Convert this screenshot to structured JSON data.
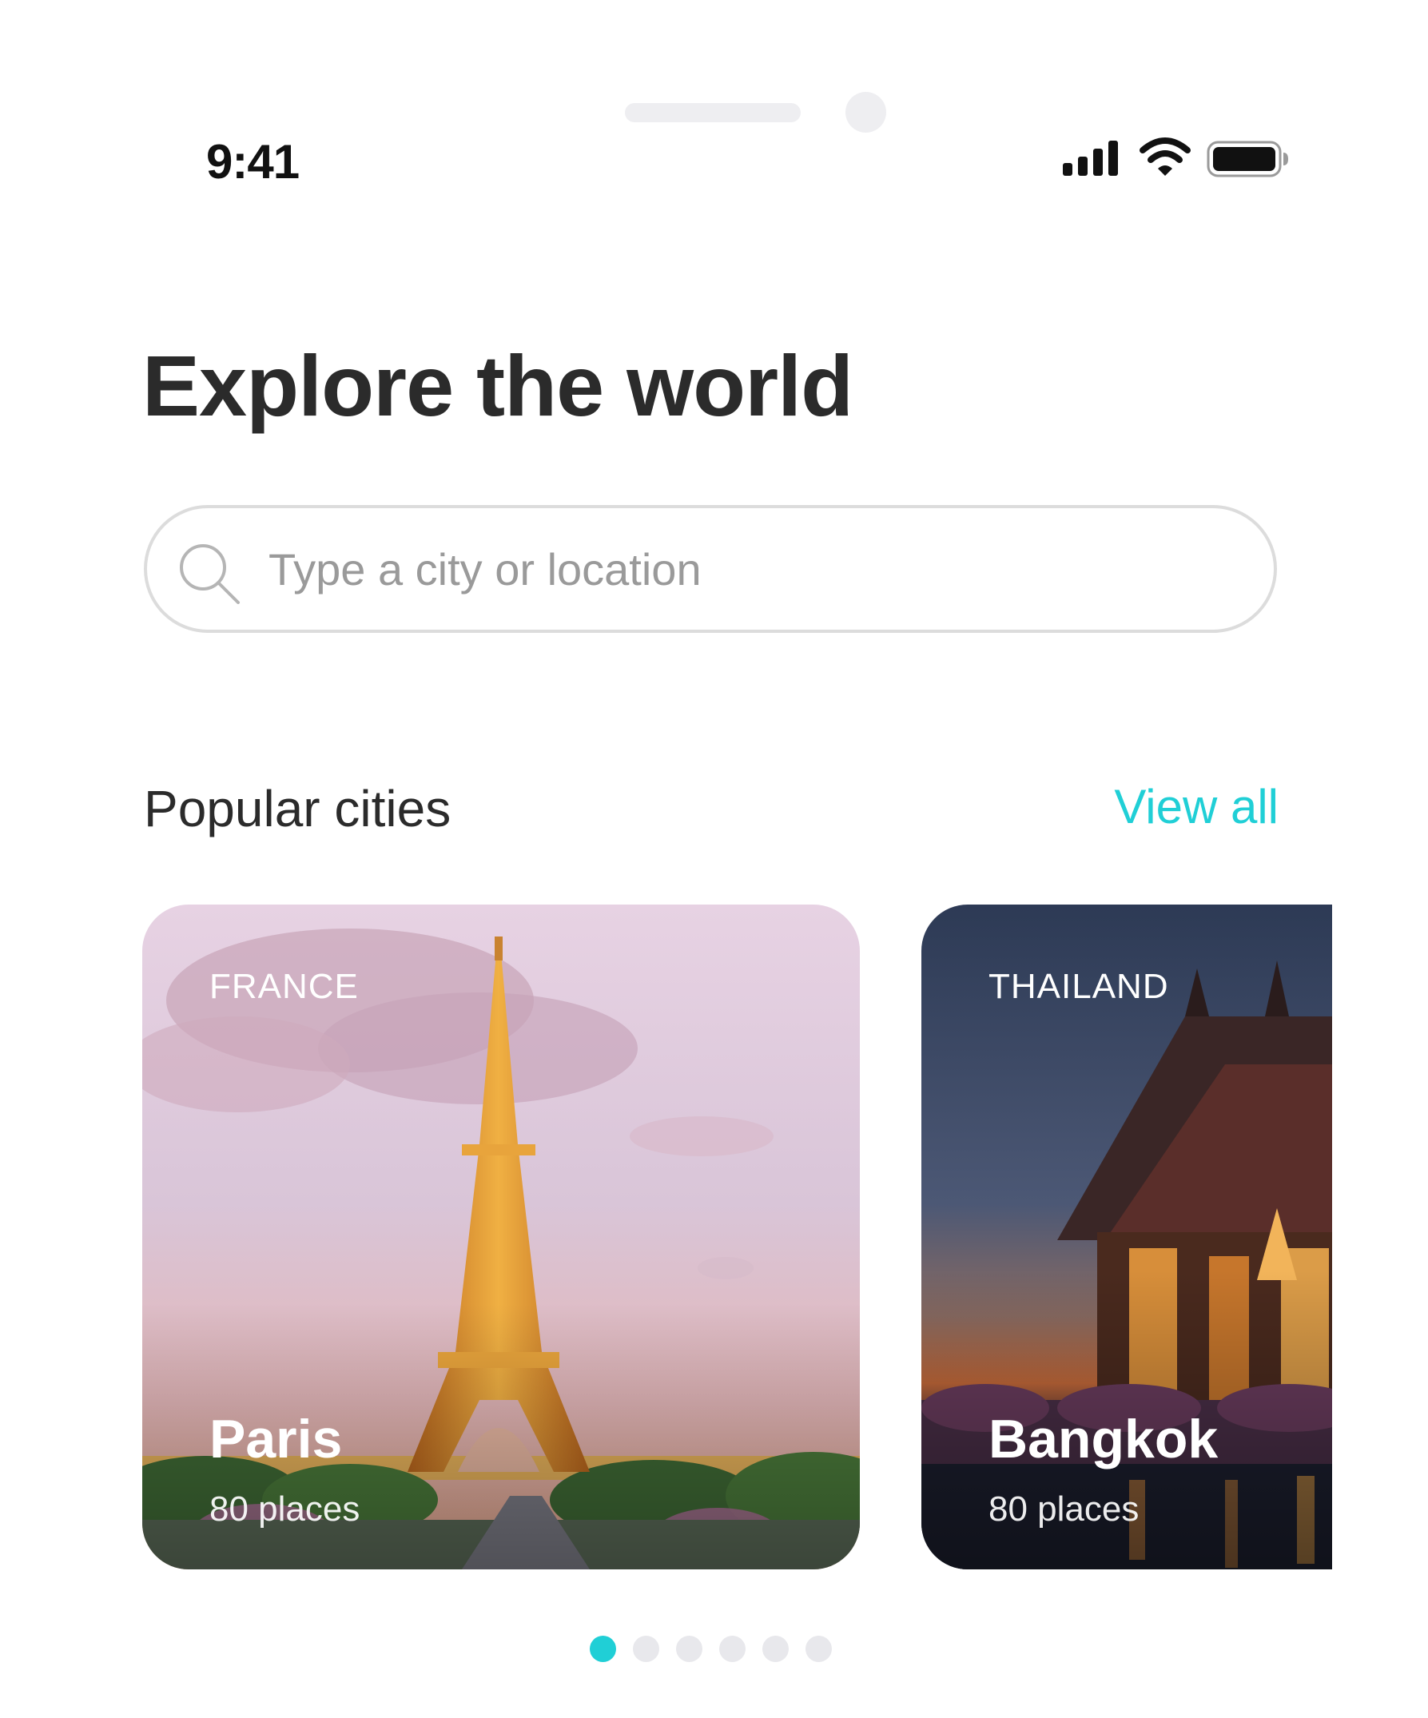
{
  "status_bar": {
    "time": "9:41",
    "icons": [
      "signal-icon",
      "wifi-icon",
      "battery-icon"
    ]
  },
  "header": {
    "title": "Explore the world"
  },
  "search": {
    "value": "",
    "placeholder": "Type a city or location",
    "icon": "search-icon"
  },
  "popular": {
    "title": "Popular cities",
    "view_all_label": "View all",
    "cards": [
      {
        "country": "FRANCE",
        "city": "Paris",
        "places": "80 places"
      },
      {
        "country": "THAILAND",
        "city": "Bangkok",
        "places": "80 places"
      }
    ]
  },
  "pagination": {
    "total": 6,
    "active_index": 0
  },
  "colors": {
    "accent": "#20cfd6",
    "text": "#2b2b2b",
    "placeholder": "#9a9a9a",
    "dot_inactive": "#e8e8ec"
  }
}
